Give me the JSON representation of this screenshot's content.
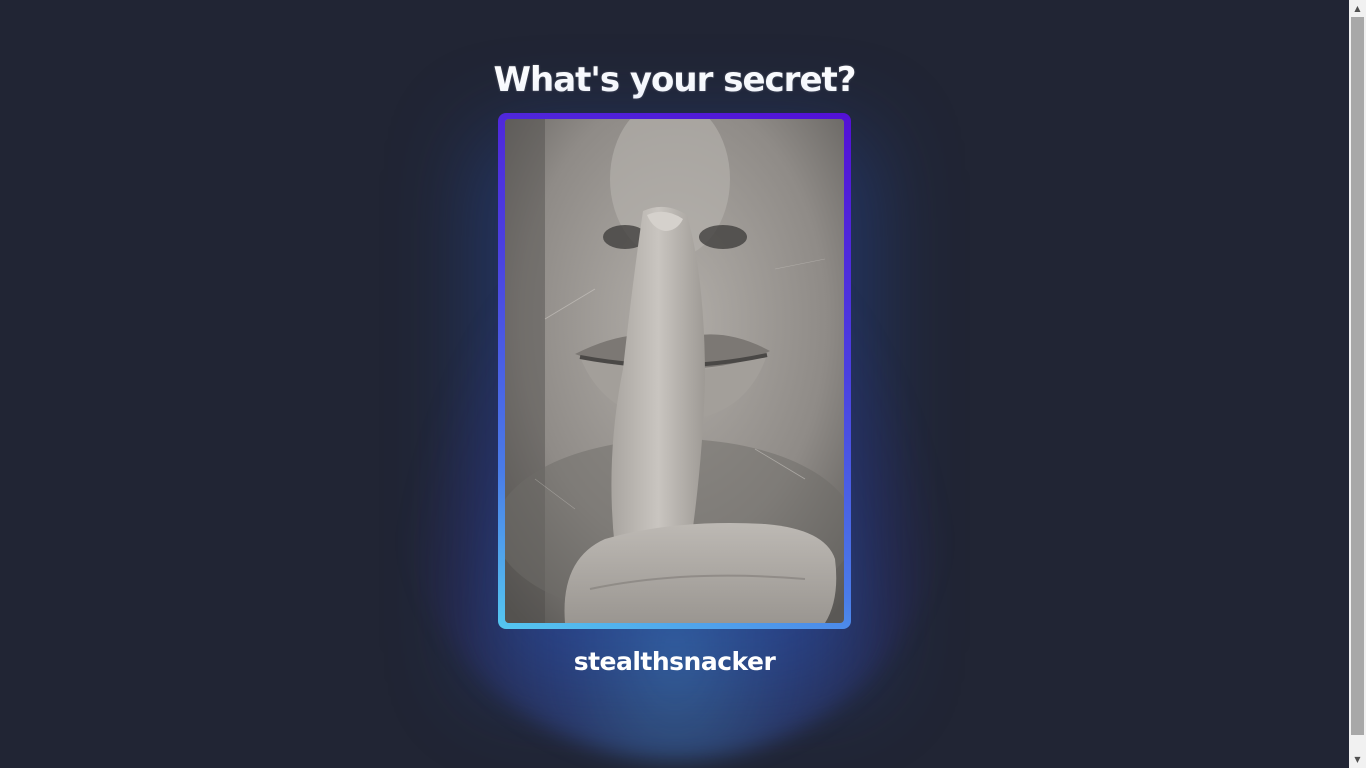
{
  "page": {
    "title": "What's your secret?",
    "username": "stealthsnacker"
  },
  "card": {
    "image": "photo of person holding finger over lips (shush gesture), black and white",
    "border_gradient": [
      "#5310d6",
      "#4b3fe0",
      "#4a7be8",
      "#55c8f0"
    ]
  },
  "colors": {
    "background": "#212534",
    "text": "#ffffff",
    "glow": "#468cd2"
  },
  "scrollbar": {
    "up_icon": "▲",
    "down_icon": "▼"
  }
}
